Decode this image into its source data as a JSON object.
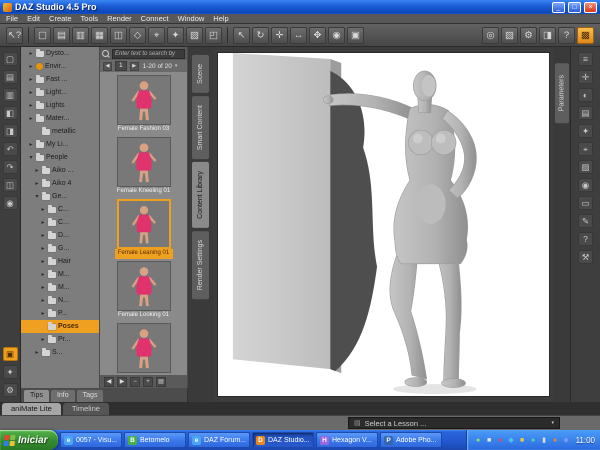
{
  "titlebar": {
    "title": "DAZ Studio 4.5 Pro",
    "minimize": "_",
    "maximize": "□",
    "close": "×"
  },
  "menu": {
    "items": [
      "File",
      "Edit",
      "Create",
      "Tools",
      "Render",
      "Connect",
      "Window",
      "Help"
    ]
  },
  "toolbar": {
    "groups": [
      {
        "icons": [
          {
            "name": "context-help-icon",
            "glyph": "↖?"
          }
        ]
      },
      {
        "icons": [
          {
            "name": "new-scene-icon",
            "glyph": "▢"
          },
          {
            "name": "open-scene-icon",
            "glyph": "▤"
          },
          {
            "name": "save-scene-icon",
            "glyph": "▥"
          },
          {
            "name": "create-cube-icon",
            "glyph": "▦"
          },
          {
            "name": "create-group-icon",
            "glyph": "◫"
          },
          {
            "name": "create-null-icon",
            "glyph": "◇"
          },
          {
            "name": "create-camera-icon",
            "glyph": "⌖"
          },
          {
            "name": "create-light-icon",
            "glyph": "✦"
          },
          {
            "name": "create-plane-icon",
            "glyph": "▧"
          },
          {
            "name": "fit-view-icon",
            "glyph": "◰"
          }
        ]
      },
      {
        "icons": [
          {
            "name": "node-selection-icon",
            "glyph": "↖"
          },
          {
            "name": "rotate-tool-icon",
            "glyph": "↻"
          },
          {
            "name": "translate-tool-icon",
            "glyph": "✛"
          },
          {
            "name": "scale-tool-icon",
            "glyph": "↔"
          },
          {
            "name": "universal-tool-icon",
            "glyph": "✥"
          },
          {
            "name": "surface-selection-icon",
            "glyph": "◉"
          },
          {
            "name": "frame-tool-icon",
            "glyph": "▣"
          }
        ]
      },
      {
        "icons": [
          {
            "name": "camera-view-icon",
            "glyph": "◎"
          },
          {
            "name": "render-icon",
            "glyph": "▨"
          },
          {
            "name": "render-settings-icon",
            "glyph": "⚙"
          },
          {
            "name": "aux-viewport-icon",
            "glyph": "◨"
          },
          {
            "name": "help-icon",
            "glyph": "?"
          },
          {
            "name": "active-pane-icon",
            "glyph": "▩",
            "active": true
          }
        ]
      }
    ]
  },
  "left_rail": {
    "top": [
      {
        "name": "file-new-icon",
        "glyph": "▢"
      },
      {
        "name": "folder-open-icon",
        "glyph": "▤"
      },
      {
        "name": "save-icon",
        "glyph": "▥"
      },
      {
        "name": "import-icon",
        "glyph": "◧"
      },
      {
        "name": "export-icon",
        "glyph": "◨"
      },
      {
        "name": "undo-icon",
        "glyph": "↶"
      },
      {
        "name": "redo-icon",
        "glyph": "↷"
      },
      {
        "name": "scene-info-icon",
        "glyph": "◫"
      },
      {
        "name": "puppeteer-icon",
        "glyph": "◉"
      }
    ],
    "bottom": [
      {
        "name": "content-folder-icon",
        "glyph": "▣",
        "active": true
      },
      {
        "name": "lights-icon",
        "glyph": "✦"
      },
      {
        "name": "settings-icon",
        "glyph": "⚙"
      }
    ]
  },
  "right_rail": {
    "icons": [
      {
        "name": "parameters-rail-icon",
        "glyph": "≡"
      },
      {
        "name": "posing-icon",
        "glyph": "✛"
      },
      {
        "name": "shaping-icon",
        "glyph": "◐"
      },
      {
        "name": "surfaces-icon",
        "glyph": "▤"
      },
      {
        "name": "lights-panel-icon",
        "glyph": "✦"
      },
      {
        "name": "cameras-panel-icon",
        "glyph": "⌖"
      },
      {
        "name": "render-panel-icon",
        "glyph": "▨"
      },
      {
        "name": "puppeteer-panel-icon",
        "glyph": "◉"
      },
      {
        "name": "timeline-panel-icon",
        "glyph": "▭"
      },
      {
        "name": "scripts-icon",
        "glyph": "✎"
      },
      {
        "name": "help-panel-icon",
        "glyph": "?"
      },
      {
        "name": "tool-settings-icon",
        "glyph": "⚒"
      }
    ]
  },
  "content_library": {
    "search_placeholder": "Enter text to search by",
    "page": "1",
    "range": "1-20 of 20",
    "tree": [
      {
        "label": "Dysto...",
        "indent": 1,
        "arrow": "right",
        "icon": "folder"
      },
      {
        "label": "Envir...",
        "indent": 1,
        "arrow": "right",
        "icon": "circle"
      },
      {
        "label": "Fast ...",
        "indent": 1,
        "arrow": "right",
        "icon": "folder"
      },
      {
        "label": "Light...",
        "indent": 1,
        "arrow": "right",
        "icon": "folder"
      },
      {
        "label": "Lights",
        "indent": 1,
        "arrow": "right",
        "icon": "folder"
      },
      {
        "label": "Mater...",
        "indent": 1,
        "arrow": "right",
        "icon": "folder"
      },
      {
        "label": "metallic",
        "indent": 2,
        "icon": "folder"
      },
      {
        "label": "My Li...",
        "indent": 1,
        "arrow": "right",
        "icon": "folder"
      },
      {
        "label": "People",
        "indent": 1,
        "arrow": "down",
        "icon": "folder"
      },
      {
        "label": "Aiko ...",
        "indent": 2,
        "arrow": "right",
        "icon": "folder"
      },
      {
        "label": "Aiko 4",
        "indent": 2,
        "arrow": "right",
        "icon": "folder"
      },
      {
        "label": "Ge...",
        "indent": 2,
        "arrow": "down",
        "icon": "folder"
      },
      {
        "label": "C...",
        "indent": 3,
        "arrow": "right",
        "icon": "folder"
      },
      {
        "label": "C...",
        "indent": 3,
        "arrow": "right",
        "icon": "folder"
      },
      {
        "label": "D...",
        "indent": 3,
        "arrow": "right",
        "icon": "folder"
      },
      {
        "label": "G...",
        "indent": 3,
        "arrow": "right",
        "icon": "folder"
      },
      {
        "label": "Hair",
        "indent": 3,
        "arrow": "right",
        "icon": "folder"
      },
      {
        "label": "M...",
        "indent": 3,
        "arrow": "right",
        "icon": "folder"
      },
      {
        "label": "M...",
        "indent": 3,
        "arrow": "right",
        "icon": "folder"
      },
      {
        "label": "N...",
        "indent": 3,
        "arrow": "right",
        "icon": "folder"
      },
      {
        "label": "P...",
        "indent": 3,
        "arrow": "right",
        "icon": "folder"
      },
      {
        "label": "Poses",
        "indent": 3,
        "selected": true,
        "icon": "folder"
      },
      {
        "label": "Pr...",
        "indent": 3,
        "arrow": "right",
        "icon": "folder"
      },
      {
        "label": "S...",
        "indent": 2,
        "arrow": "right",
        "icon": "folder"
      }
    ],
    "thumbnails": [
      {
        "label": "Female Fashion 03"
      },
      {
        "label": "Female Kneeling 01"
      },
      {
        "label": "Female Leaning 01",
        "selected": true
      },
      {
        "label": "Female Looking 01"
      },
      {
        "label": ""
      }
    ],
    "footer_icons": [
      {
        "name": "prev-page-icon",
        "glyph": "◀"
      },
      {
        "name": "next-page-icon",
        "glyph": "▶"
      },
      {
        "name": "zoom-out-icon",
        "glyph": "−"
      },
      {
        "name": "zoom-in-icon",
        "glyph": "+"
      },
      {
        "name": "view-mode-icon",
        "glyph": "▤"
      }
    ],
    "bottom_tabs": [
      {
        "label": "Tips",
        "active": true
      },
      {
        "label": "Info"
      },
      {
        "label": "Tags"
      }
    ]
  },
  "side_tabs": {
    "left": [
      {
        "label": "Scene"
      },
      {
        "label": "Smart Content"
      },
      {
        "label": "Content Library",
        "active": true
      },
      {
        "label": "Render Settings"
      }
    ],
    "right": [
      {
        "label": "Parameters"
      }
    ]
  },
  "bottom_bar": {
    "tabs": [
      {
        "label": "aniMate Lite",
        "active": true
      },
      {
        "label": "Timeline"
      }
    ],
    "lesson": "Select a Lesson ..."
  },
  "taskbar": {
    "start": "Iniciar",
    "items": [
      {
        "label": "0057 - Visu...",
        "initial": "e",
        "icon_color": "#4aa6f5"
      },
      {
        "label": "Betomelo",
        "initial": "B",
        "icon_color": "#46b046"
      },
      {
        "label": "DAZ Fórum...",
        "initial": "e",
        "icon_color": "#4aa6f5"
      },
      {
        "label": "DAZ Studio...",
        "initial": "D",
        "icon_color": "#e8881a",
        "active": true
      },
      {
        "label": "Hexagon V...",
        "initial": "H",
        "icon_color": "#9a66e0"
      },
      {
        "label": "Adobe Pho...",
        "initial": "P",
        "icon_color": "#3566b0"
      }
    ],
    "tray": [
      {
        "name": "tray-icon",
        "glyph": "●",
        "color": "#8ee85a"
      },
      {
        "name": "tray-icon",
        "glyph": "■",
        "color": "#e8e8e8"
      },
      {
        "name": "tray-icon",
        "glyph": "●",
        "color": "#f04848"
      },
      {
        "name": "tray-icon",
        "glyph": "◆",
        "color": "#48c8f0"
      },
      {
        "name": "tray-icon",
        "glyph": "■",
        "color": "#f0c848"
      },
      {
        "name": "tray-icon",
        "glyph": "●",
        "color": "#48e0a8"
      },
      {
        "name": "tray-icon",
        "glyph": "▮",
        "color": "#d8d8d8"
      },
      {
        "name": "tray-icon",
        "glyph": "●",
        "color": "#f08828"
      },
      {
        "name": "tray-icon",
        "glyph": "◆",
        "color": "#7a9af8"
      }
    ],
    "clock": "11:00"
  },
  "icons": {
    "prev": "◀",
    "next": "▶",
    "chevron_down": "▾"
  },
  "accent": {
    "selection_orange": "#f0a020",
    "taskbar_blue": "#2258cf",
    "start_green": "#358a2e"
  }
}
